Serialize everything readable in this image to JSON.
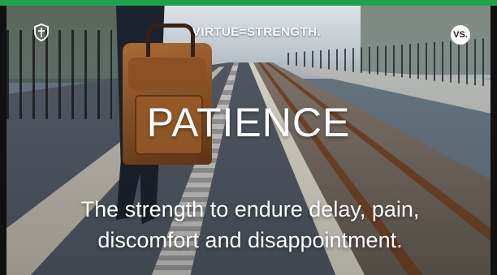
{
  "brand": {
    "title": "VIRTUE=STRENGTH.",
    "badge": "VS.",
    "logo_icon": "shield-cross-icon",
    "accent": "#1fa34a"
  },
  "card": {
    "headline": "PATIENCE",
    "subtext_line1": "The strength to endure delay, pain,",
    "subtext_line2": "discomfort and disappointment."
  }
}
